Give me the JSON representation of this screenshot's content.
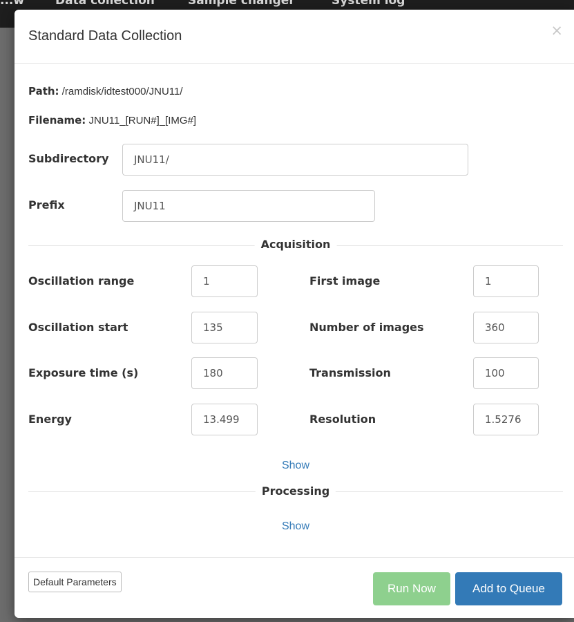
{
  "background": {
    "nav_items": [
      "...w",
      "Data collection",
      "Sample changer",
      "System log"
    ]
  },
  "modal": {
    "title": "Standard Data Collection",
    "close_symbol": "×"
  },
  "info": {
    "path_label": "Path:",
    "path_value": "/ramdisk/idtest000/JNU11/",
    "filename_label": "Filename:",
    "filename_value": "JNU11_[RUN#]_[IMG#]"
  },
  "fields": {
    "subdirectory": {
      "label": "Subdirectory",
      "value": "JNU11/"
    },
    "prefix": {
      "label": "Prefix",
      "value": "JNU11"
    }
  },
  "acquisition": {
    "title": "Acquisition",
    "oscillation_range": {
      "label": "Oscillation range",
      "value": "1"
    },
    "first_image": {
      "label": "First image",
      "value": "1"
    },
    "oscillation_start": {
      "label": "Oscillation start",
      "value": "135"
    },
    "number_of_images": {
      "label": "Number of images",
      "value": "360"
    },
    "exposure_time": {
      "label": "Exposure time (s)",
      "value": "180"
    },
    "transmission": {
      "label": "Transmission",
      "value": "100"
    },
    "energy": {
      "label": "Energy",
      "value": "13.499"
    },
    "resolution": {
      "label": "Resolution",
      "value": "1.5276"
    },
    "show_label": "Show"
  },
  "processing": {
    "title": "Processing",
    "show_label": "Show"
  },
  "footer": {
    "default_params_label": "Default Parameters",
    "run_now_label": "Run Now",
    "add_to_queue_label": "Add to Queue"
  },
  "colors": {
    "primary": "#337ab7",
    "success_disabled": "#8ed08e",
    "link": "#337ab7"
  }
}
